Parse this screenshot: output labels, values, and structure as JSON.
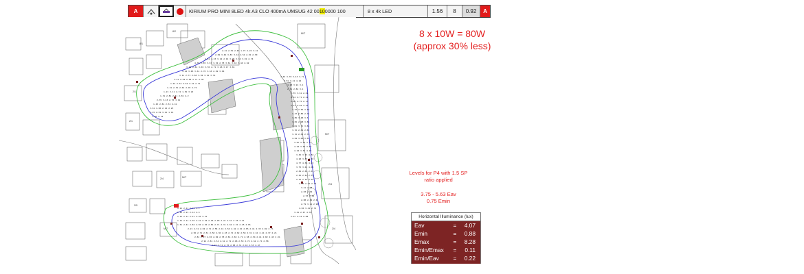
{
  "toolbar": {
    "left_badge": "A",
    "right_badge": "A",
    "luminaire_description": "KIRIUM PRO MINI 8LED 4k A3 CLO 400mA UMSUG 42 00",
    "highlight_text": "10",
    "description_suffix": " 0000 100",
    "arrangement": "8 x 4k LED",
    "value_1": "1.56",
    "value_2": "8",
    "value_3": "0.92"
  },
  "power": {
    "line1": "8 x 10W = 80W",
    "line2": "(approx 30% less)"
  },
  "note": {
    "line1": "Levels for P4 with 1.5 SP",
    "line2": "ratio applied",
    "line3": "3.75 - 5.63 Eav",
    "line4": "0.75 Emin"
  },
  "illuminance": {
    "title": "Horizontal Illuminance (lux)",
    "rows": [
      {
        "key": "Eav",
        "value": "4.07"
      },
      {
        "key": "Emin",
        "value": "0.88"
      },
      {
        "key": "Emax",
        "value": "8.28"
      },
      {
        "key": "Emin/Emax",
        "value": "0.11"
      },
      {
        "key": "Emin/Eav",
        "value": "0.22"
      }
    ]
  },
  "colors": {
    "accent_red": "#e32020",
    "panel_brown": "#7d2424",
    "contour_green": "#3fbf3f",
    "contour_blue": "#3a3ad8"
  },
  "icons": [
    "badge-a",
    "luminaire-icon",
    "selected-luminaire-icon",
    "red-dot-icon"
  ]
}
